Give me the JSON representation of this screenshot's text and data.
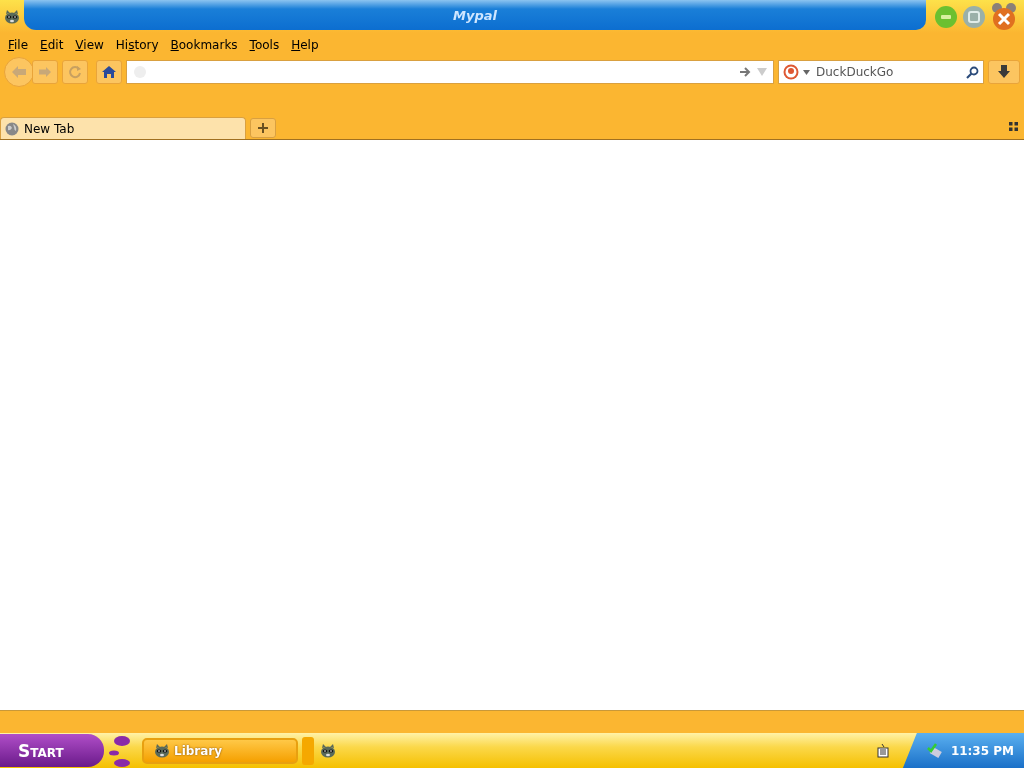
{
  "window": {
    "title": "Mypal"
  },
  "menu": [
    {
      "key": "F",
      "after": "ile"
    },
    {
      "key": "E",
      "after": "dit"
    },
    {
      "key": "V",
      "after": "iew"
    },
    {
      "before": "Hi",
      "key": "s",
      "after": "tory"
    },
    {
      "key": "B",
      "after": "ookmarks"
    },
    {
      "key": "T",
      "after": "ools"
    },
    {
      "key": "H",
      "after": "elp"
    }
  ],
  "search": {
    "placeholder": "DuckDuckGo"
  },
  "tabs": [
    {
      "label": "New Tab",
      "selected": true
    }
  ],
  "taskbar": {
    "start": "Start",
    "tasks": [
      {
        "label": "Library",
        "selected": false
      }
    ],
    "clock": "11:35 PM"
  }
}
